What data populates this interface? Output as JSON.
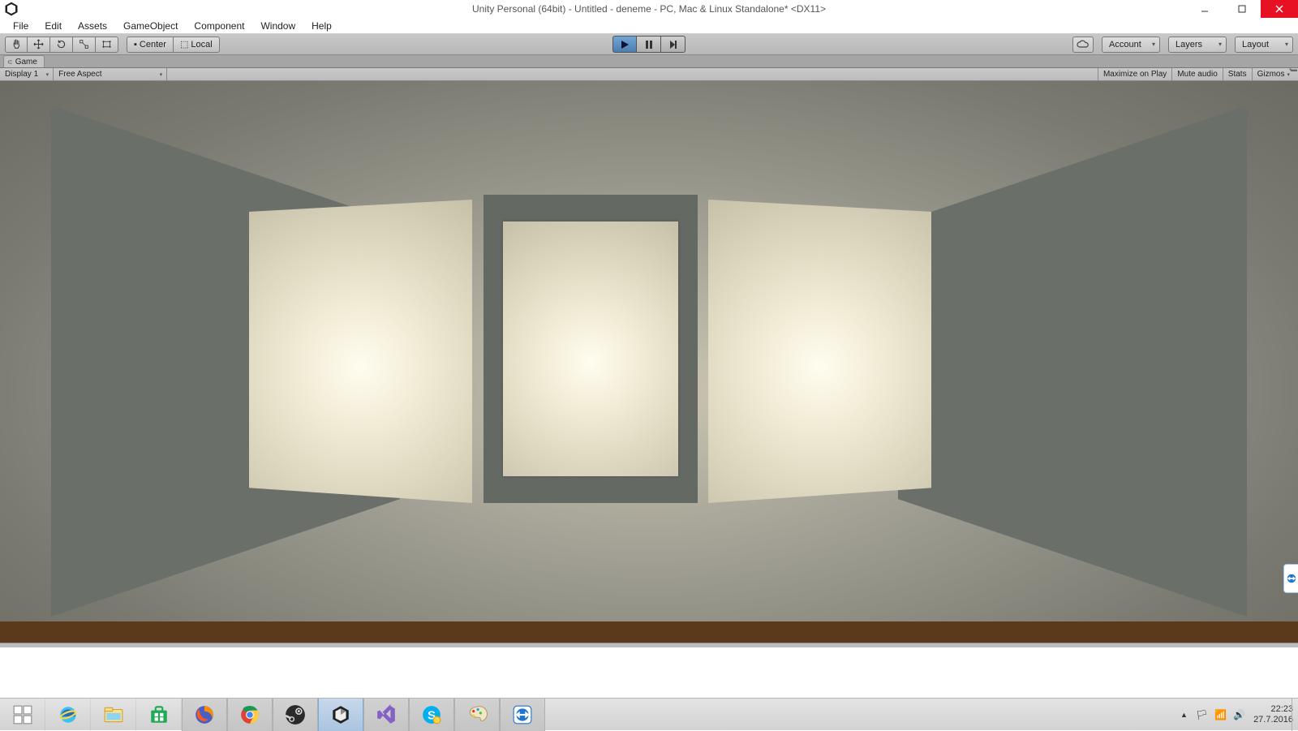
{
  "window": {
    "title": "Unity Personal (64bit) - Untitled - deneme - PC, Mac & Linux Standalone* <DX11>"
  },
  "menubar": {
    "items": [
      "File",
      "Edit",
      "Assets",
      "GameObject",
      "Component",
      "Window",
      "Help"
    ]
  },
  "toolbar": {
    "center_label": "Center",
    "local_label": "Local",
    "account_label": "Account",
    "layers_label": "Layers",
    "layout_label": "Layout"
  },
  "tabs": {
    "game": "Game"
  },
  "game_subbar": {
    "display": "Display 1",
    "aspect": "Free Aspect",
    "maximize": "Maximize on Play",
    "mute": "Mute audio",
    "stats": "Stats",
    "gizmos": "Gizmos"
  },
  "taskbar_tray": {
    "time": "22:23",
    "date": "27.7.2016"
  }
}
